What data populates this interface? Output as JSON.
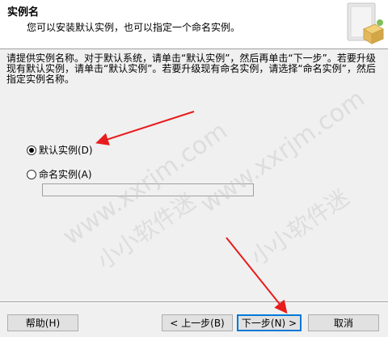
{
  "header": {
    "title": "实例名",
    "subtitle": "您可以安装默认实例，也可以指定一个命名实例。",
    "graphic_icon": "install-box-icon"
  },
  "instructions": "请提供实例名称。对于默认系统，请单击“默认实例”，然后再单击“下一步”。若要升级现有默认实例，请单击“默认实例”。若要升级现有命名实例，请选择“命名实例”，然后指定实例名称。",
  "options": {
    "default_instance": {
      "label": "默认实例(D)",
      "checked": true
    },
    "named_instance": {
      "label": "命名实例(A)",
      "checked": false
    },
    "instance_name_value": ""
  },
  "buttons": {
    "help": "帮助(H)",
    "back": "< 上一步(B)",
    "next": "下一步(N) >",
    "cancel": "取消"
  },
  "watermarks": [
    "www.xxrjm.com",
    "小小软件迷"
  ],
  "colors": {
    "arrow": "#e81c1c",
    "default_button_border": "#0078d7",
    "window_bg": "#f0f0f0"
  }
}
